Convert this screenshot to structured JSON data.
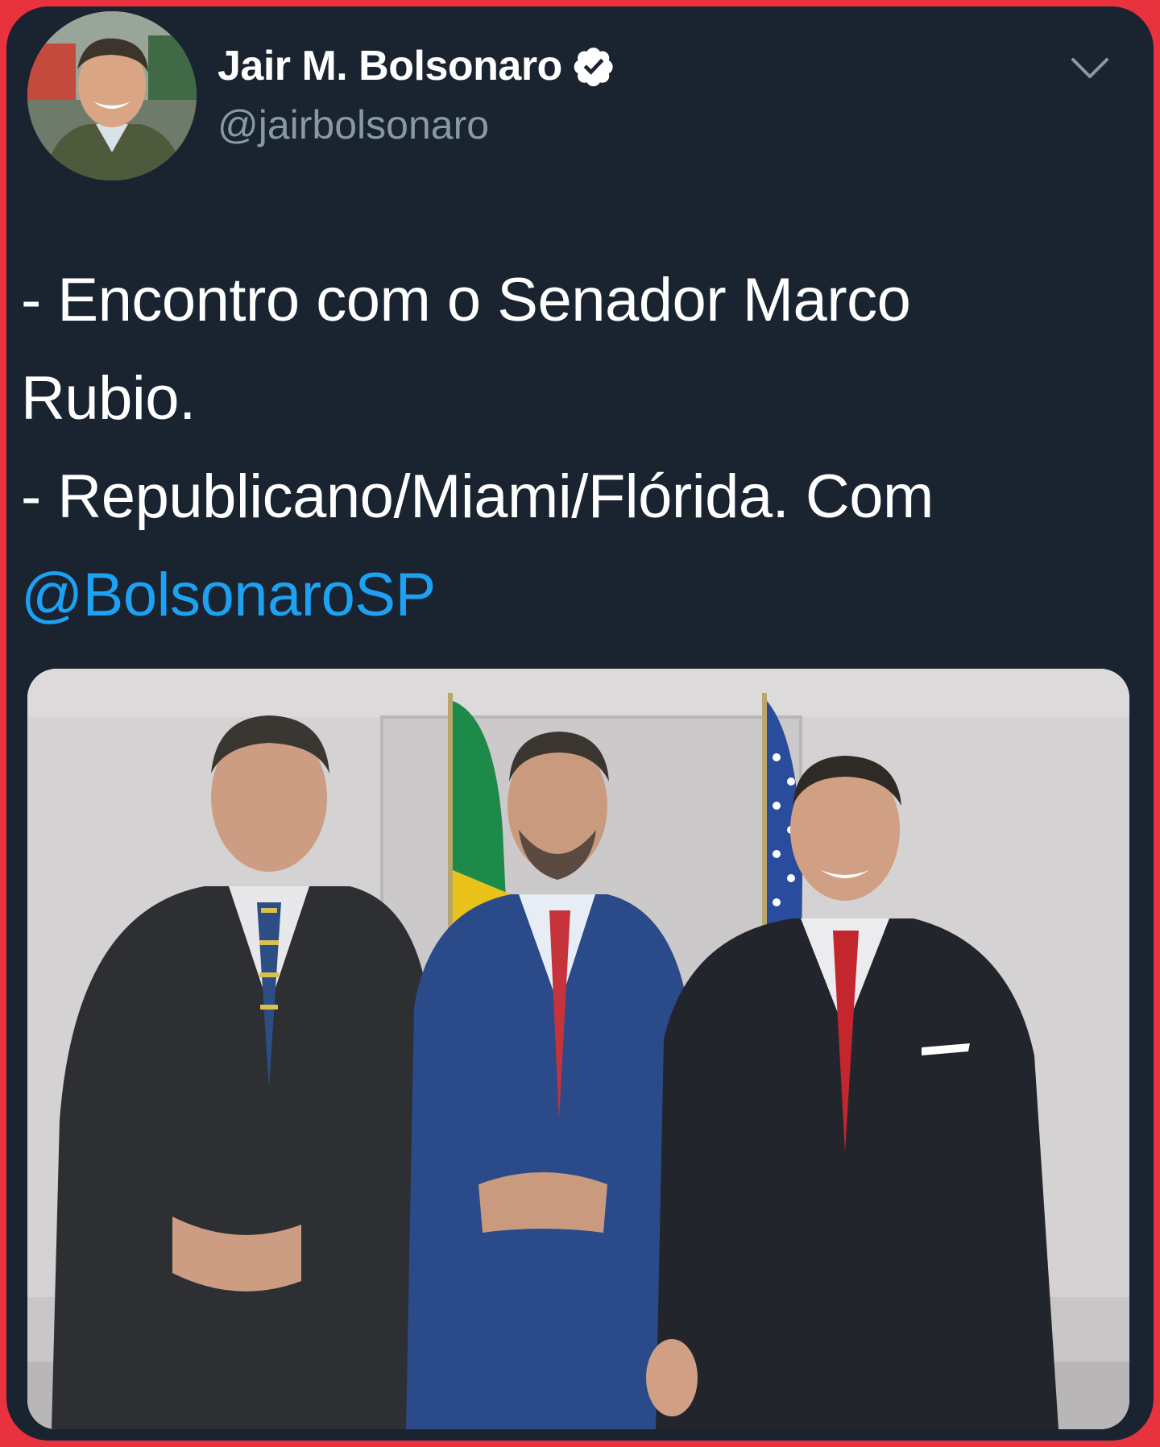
{
  "tweet": {
    "author": {
      "display_name": "Jair M. Bolsonaro",
      "handle": "@jairbolsonaro",
      "verified": true
    },
    "text_lines": [
      "- Encontro com o Senador Marco",
      "Rubio.",
      "- Republicano/Miami/Flórida. Com"
    ],
    "mention": "@BolsonaroSP",
    "icons": {
      "verified": "verified-badge-icon",
      "menu": "chevron-down-icon"
    }
  },
  "colors": {
    "frame_border": "#e8333f",
    "background": "#1a2330",
    "text": "#ffffff",
    "secondary_text": "#8899a6",
    "link": "#1da1f2"
  }
}
